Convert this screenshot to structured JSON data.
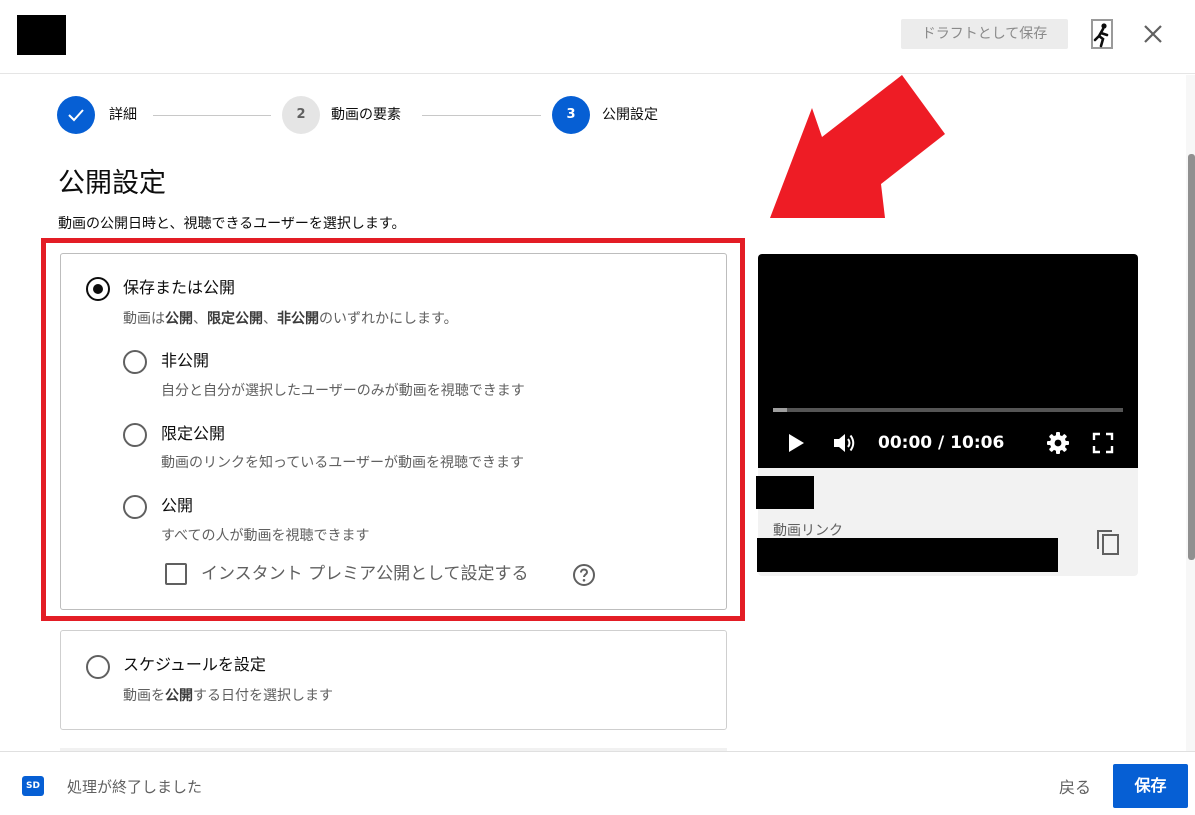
{
  "header": {
    "draft_button": "ドラフトとして保存"
  },
  "stepper": {
    "steps": [
      {
        "number": "",
        "label": "詳細",
        "state": "done"
      },
      {
        "number": "2",
        "label": "動画の要素",
        "state": "pending"
      },
      {
        "number": "3",
        "label": "公開設定",
        "state": "current"
      }
    ]
  },
  "page": {
    "title": "公開設定",
    "subtitle": "動画の公開日時と、視聴できるユーザーを選択します。"
  },
  "save_or_publish": {
    "title": "保存または公開",
    "desc_parts": [
      "動画は",
      "公開",
      "、",
      "限定公開",
      "、",
      "非公開",
      "のいずれかにします。"
    ],
    "selected": true,
    "options": [
      {
        "title": "非公開",
        "desc": "自分と自分が選択したユーザーのみが動画を視聴できます",
        "selected": false
      },
      {
        "title": "限定公開",
        "desc": "動画のリンクを知っているユーザーが動画を視聴できます",
        "selected": false
      },
      {
        "title": "公開",
        "desc": "すべての人が動画を視聴できます",
        "selected": false
      }
    ],
    "premiere_checkbox": {
      "label": "インスタント プレミア公開として設定する",
      "checked": false
    }
  },
  "schedule": {
    "title": "スケジュールを設定",
    "desc_parts": [
      "動画を",
      "公開",
      "する日付を選択します"
    ],
    "selected": false
  },
  "video": {
    "time": "00:00 / 10:06",
    "progress": 0.04,
    "link_label": "動画リンク"
  },
  "footer": {
    "badge": "SD",
    "status": "処理が終了しました",
    "back_button": "戻る",
    "save_button": "保存"
  },
  "colors": {
    "accent": "#065fd4",
    "annotation": "#e31d25"
  },
  "icons": [
    "check-icon",
    "exit-icon",
    "close-icon",
    "play-icon",
    "volume-icon",
    "settings-icon",
    "fullscreen-icon",
    "copy-icon",
    "help-icon"
  ]
}
